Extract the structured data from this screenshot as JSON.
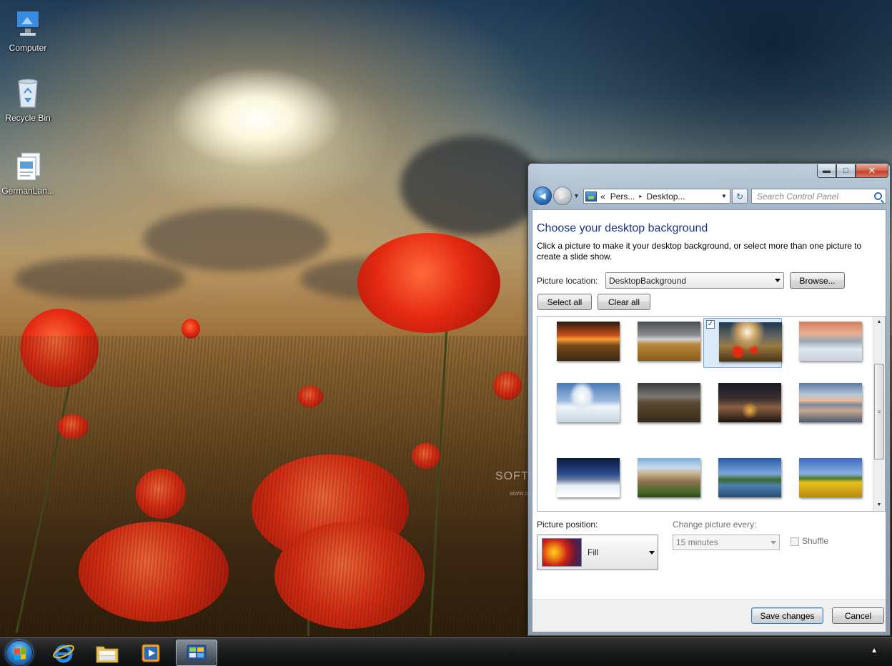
{
  "desktop": {
    "icons": [
      {
        "label": "Computer",
        "icon": "computer-icon"
      },
      {
        "label": "Recycle Bin",
        "icon": "recycle-bin-icon"
      },
      {
        "label": "GermanLan...",
        "icon": "document-icon"
      }
    ]
  },
  "window": {
    "caption": {
      "minimize": "▬",
      "maximize": "□",
      "close": "✕"
    },
    "nav": {
      "back_glyph": "◀",
      "forward_glyph": "▶",
      "history_glyph": "▼",
      "breadcrumb_prefix": "«",
      "breadcrumb": [
        "Pers...",
        "Desktop..."
      ],
      "breadcrumb_sep": "▸",
      "dropdown_glyph": "▼",
      "refresh_glyph": "↻",
      "search_placeholder": "Search Control Panel"
    },
    "page": {
      "title": "Choose your desktop background",
      "description": "Click a picture to make it your desktop background, or select more than one picture to create a slide show.",
      "location_label": "Picture location:",
      "location_value": "DesktopBackground",
      "browse_label": "Browse...",
      "select_all_label": "Select all",
      "clear_all_label": "Clear all",
      "thumbnails": [
        {
          "name": "orange-sunset",
          "selected": false
        },
        {
          "name": "wheat-field-storm",
          "selected": false
        },
        {
          "name": "poppy-field",
          "selected": true
        },
        {
          "name": "frozen-forest",
          "selected": false
        },
        {
          "name": "snowy-tree",
          "selected": false
        },
        {
          "name": "dirt-road",
          "selected": false
        },
        {
          "name": "night-cabin",
          "selected": false
        },
        {
          "name": "lake-reflection",
          "selected": false
        },
        {
          "name": "snowy-village",
          "selected": false
        },
        {
          "name": "rock-towers",
          "selected": false
        },
        {
          "name": "tree-by-lake",
          "selected": false
        },
        {
          "name": "golden-field",
          "selected": false
        }
      ],
      "check_glyph": "✓",
      "position_label": "Picture position:",
      "position_value": "Fill",
      "change_label": "Change picture every:",
      "change_value": "15 minutes",
      "shuffle_label": "Shuffle",
      "save_label": "Save changes",
      "cancel_label": "Cancel"
    }
  },
  "watermark": {
    "text": "SOFTPEDIA",
    "url": "www.softpedia.com"
  },
  "taskbar": {
    "items": [
      "start-orb",
      "internet-explorer-icon",
      "windows-explorer-icon",
      "media-player-icon",
      "control-panel-icon"
    ],
    "tray_arrow": "▲"
  }
}
